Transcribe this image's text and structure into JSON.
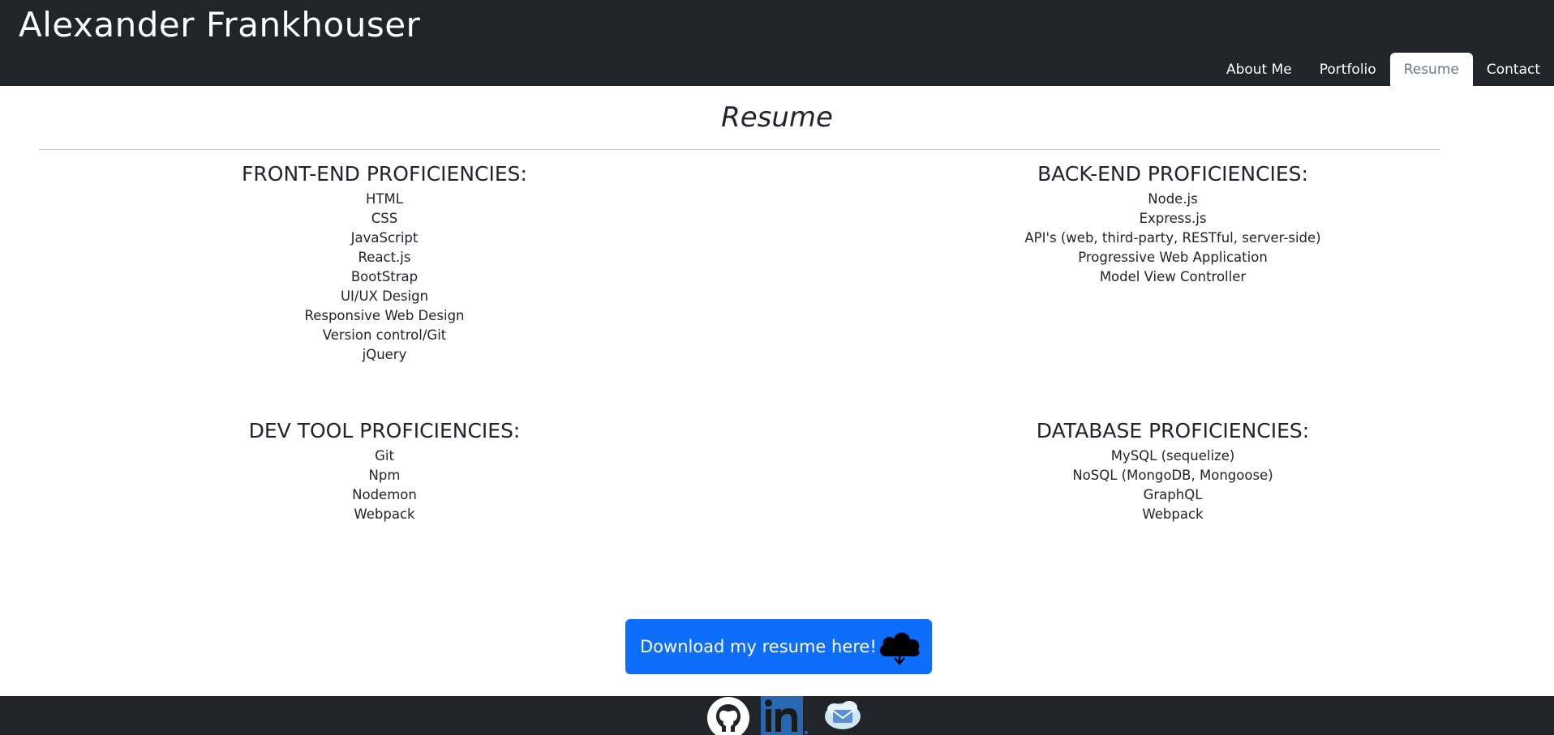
{
  "header": {
    "site_title": "Alexander Frankhouser",
    "nav": [
      {
        "label": "About Me"
      },
      {
        "label": "Portfolio"
      },
      {
        "label": "Resume"
      },
      {
        "label": "Contact"
      }
    ],
    "active_nav": "Resume"
  },
  "main": {
    "heading": "Resume",
    "sections": {
      "front_end": {
        "title": "FRONT-END PROFICIENCIES:",
        "items": [
          "HTML",
          "CSS",
          "JavaScript",
          "React.js",
          "BootStrap",
          "UI/UX Design",
          "Responsive Web Design",
          "Version control/Git",
          "jQuery"
        ]
      },
      "back_end": {
        "title": "BACK-END PROFICIENCIES:",
        "items": [
          "Node.js",
          "Express.js",
          "API's (web, third-party, RESTful, server-side)",
          "Progressive Web Application",
          "Model View Controller"
        ]
      },
      "dev_tools": {
        "title": "DEV TOOL PROFICIENCIES:",
        "items": [
          "Git",
          "Npm",
          "Nodemon",
          "Webpack"
        ]
      },
      "database": {
        "title": "DATABASE PROFICIENCIES:",
        "items": [
          "MySQL (sequelize)",
          "NoSQL (MongoDB, Mongoose)",
          "GraphQL",
          "Webpack"
        ]
      }
    },
    "download_button": {
      "label": "Download my resume here!",
      "icon": "cloud-download-icon"
    }
  },
  "footer": {
    "icons": [
      "github-icon",
      "linkedin-icon",
      "email-icon"
    ]
  },
  "colors": {
    "header_bg": "#212529",
    "button_bg": "#0d6efd",
    "active_tab_text": "#6c757d",
    "linkedin_blue": "#2867b2"
  }
}
